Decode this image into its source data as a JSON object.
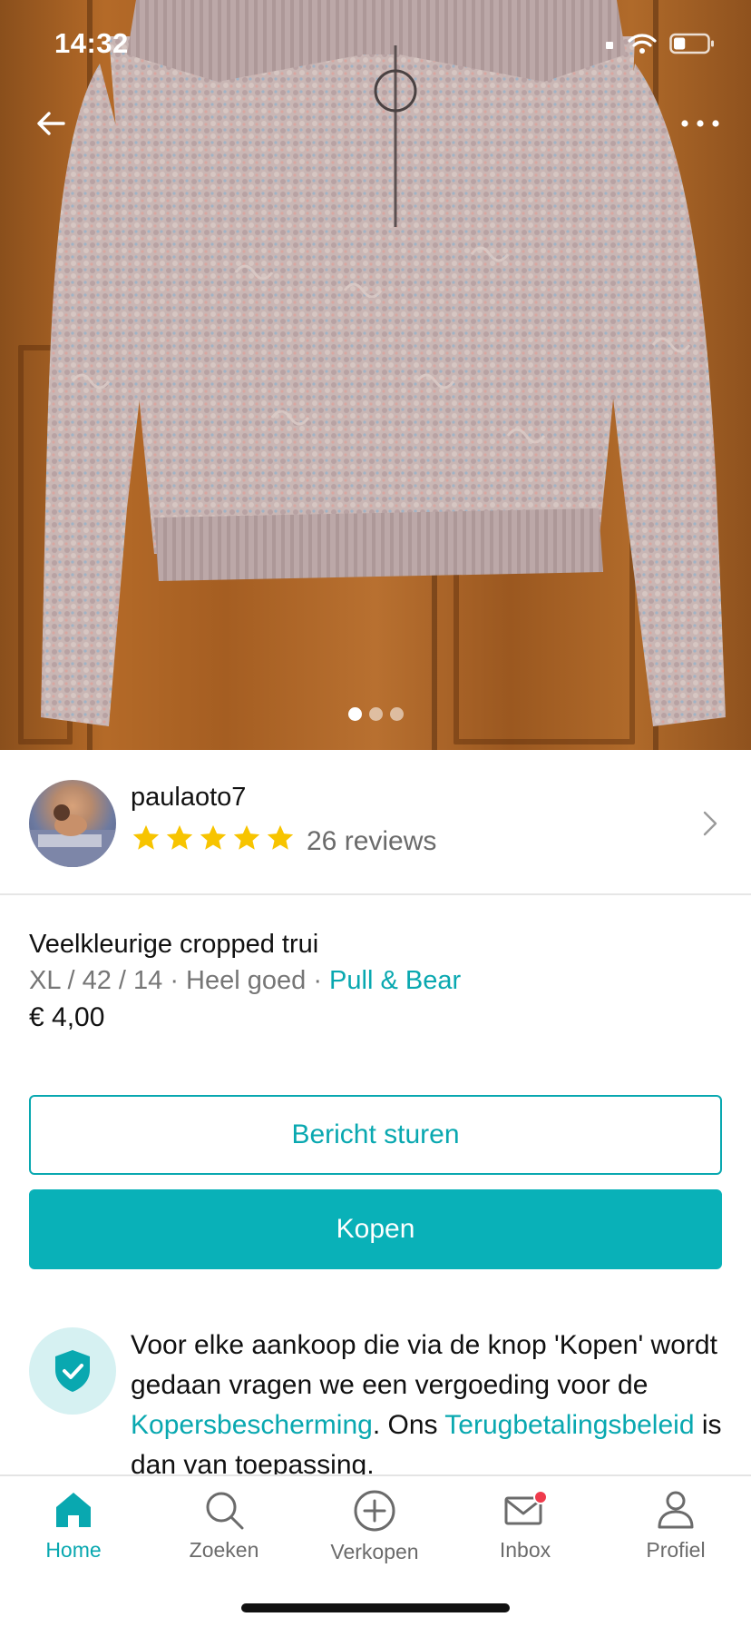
{
  "status_bar": {
    "time": "14:32",
    "battery_level": 0.35
  },
  "hero": {
    "image_alt": "Veelkleurige cropped trui",
    "page_count": 3,
    "active_page": 1
  },
  "top_bar": {
    "back_icon": "arrow-left-icon",
    "more_icon": "more-horizontal-icon"
  },
  "seller": {
    "username": "paulaoto7",
    "rating": 5,
    "rating_max": 5,
    "reviews_label": "26 reviews"
  },
  "item": {
    "title": "Veelkleurige cropped trui",
    "size": "XL / 42 / 14",
    "sep1": " · ",
    "condition": "Heel goed",
    "sep2": " · ",
    "brand": "Pull & Bear",
    "price": "€ 4,00"
  },
  "actions": {
    "message_label": "Bericht sturen",
    "buy_label": "Kopen"
  },
  "protection": {
    "text1": "Voor elke aankoop die via de knop 'Kopen' wordt gedaan vragen we een vergoeding voor de ",
    "link1": "Kopersbescherming",
    "text2": ". Ons ",
    "link2": "Terugbetalingsbeleid",
    "text3": " is dan van toepassing."
  },
  "tabbar": {
    "tabs": [
      {
        "label": "Home",
        "icon": "home-icon",
        "active": true
      },
      {
        "label": "Zoeken",
        "icon": "search-icon",
        "active": false
      },
      {
        "label": "Verkopen",
        "icon": "plus-circle-icon",
        "active": false
      },
      {
        "label": "Inbox",
        "icon": "mail-icon",
        "active": false,
        "badge": true
      },
      {
        "label": "Profiel",
        "icon": "user-icon",
        "active": false
      }
    ]
  },
  "colors": {
    "accent": "#09a8b0",
    "star": "#f7c400",
    "badge": "#ef3b4c"
  }
}
